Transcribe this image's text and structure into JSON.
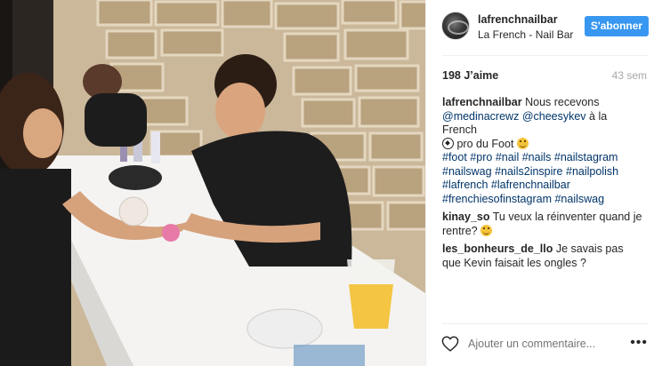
{
  "post": {
    "username": "lafrenchnailbar",
    "full_name": "La French - Nail Bar",
    "follow_label": "S'abonner",
    "likes": "198 J’aime",
    "time": "43 sem",
    "caption": {
      "user": "lafrenchnailbar",
      "text_1": "Nous recevons",
      "mention_1": "@medinacrewz",
      "mention_2": "@cheesykev",
      "text_2": "à la French",
      "text_3": "pro du Foot",
      "tags": [
        "#foot",
        "#pro",
        "#nail",
        "#nails",
        "#nailstagram",
        "#nailswag",
        "#nails2inspire",
        "#nailpolish",
        "#lafrench",
        "#lafrenchnailbar",
        "#frenchiesofinstagram",
        "#nailswag"
      ]
    },
    "comments": [
      {
        "user": "kinay_so",
        "text": "Tu veux la réinventer quand je rentre?"
      },
      {
        "user": "les_bonheurs_de_llo",
        "text": "Je savais pas que Kevin faisait les ongles ?"
      }
    ],
    "add_comment_placeholder": "Ajouter un commentaire...",
    "more_label": "•••",
    "icons": {
      "like": "heart-icon",
      "more": "more-options-icon",
      "soccer": "soccer-ball-emoji",
      "smile": "grinning-emoji"
    },
    "colors": {
      "accent": "#3897f0",
      "link": "#003569",
      "muted": "#a5a7aa"
    }
  }
}
